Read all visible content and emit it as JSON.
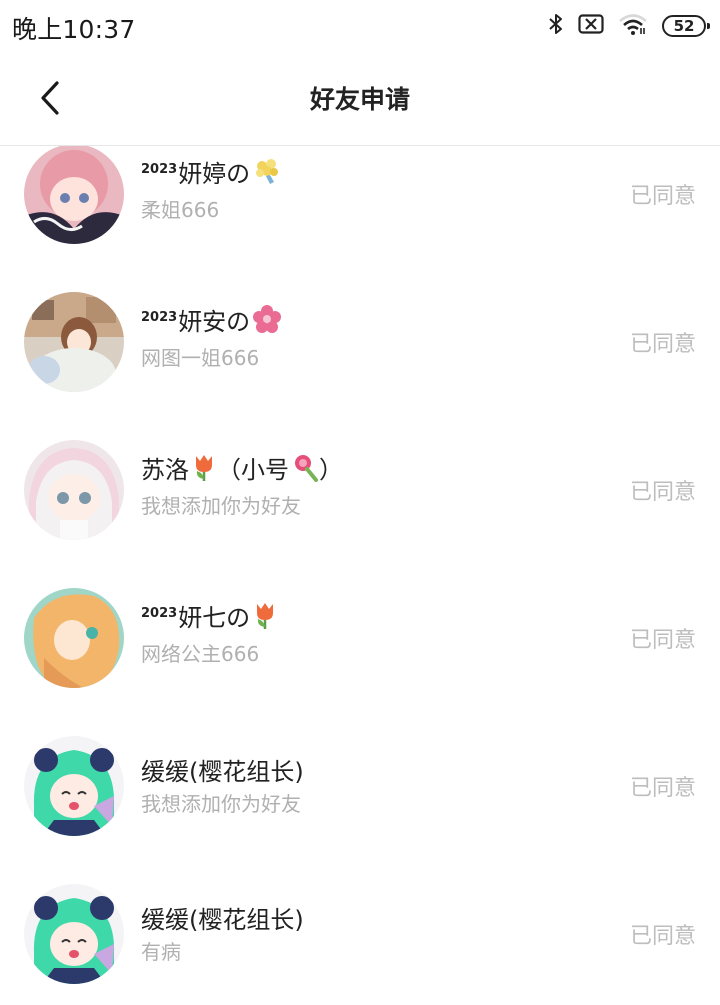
{
  "status_bar": {
    "time": "晚上10:37",
    "battery": "52",
    "icons": [
      "bluetooth-icon",
      "sim-off-icon",
      "wifi-icon",
      "battery-icon"
    ]
  },
  "header": {
    "title": "好友申请",
    "back_icon": "chevron-left-icon"
  },
  "requests": [
    {
      "name_sup": "2023",
      "name": "妍婷の",
      "emoji": "bouquet-emoji",
      "message": "柔姐666",
      "status": "已同意"
    },
    {
      "name_sup": "2023",
      "name": "妍安の",
      "emoji": "cherry-blossom-emoji",
      "message": "网图一姐666",
      "status": "已同意"
    },
    {
      "name_sup": "",
      "name": "苏洛",
      "emoji": "tulip-emoji",
      "name_suffix": "（小号",
      "emoji2": "lollipop-emoji",
      "name_end": "）",
      "message": "我想添加你为好友",
      "status": "已同意"
    },
    {
      "name_sup": "2023",
      "name": "妍七の",
      "emoji": "tulip-emoji",
      "message": "网络公主666",
      "status": "已同意"
    },
    {
      "name_sup": "",
      "name": "缓缓(樱花组长)",
      "emoji": "",
      "message": "我想添加你为好友",
      "status": "已同意"
    },
    {
      "name_sup": "",
      "name": "缓缓(樱花组长)",
      "emoji": "",
      "message": "有病",
      "status": "已同意"
    }
  ],
  "colors": {
    "title": "#222222",
    "secondary": "#b0b0b0",
    "status": "#bdbdbd",
    "divider": "#e6e6e6"
  }
}
